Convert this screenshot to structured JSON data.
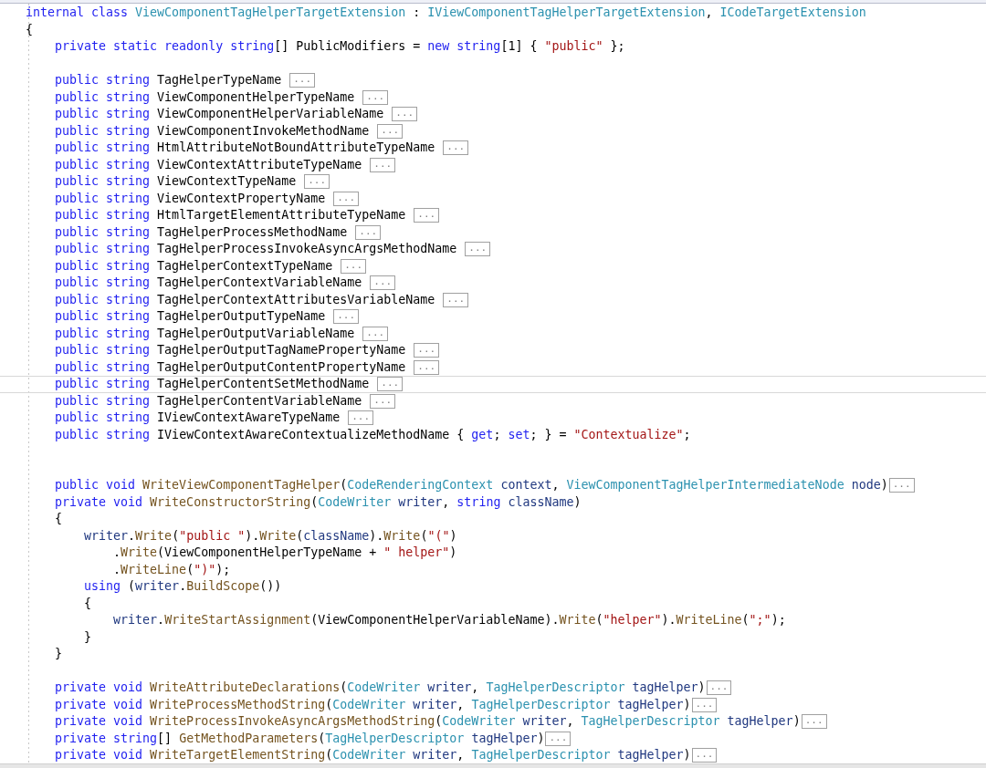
{
  "editor": {
    "lines": [
      {
        "kind": "code",
        "current": false,
        "tokens": [
          {
            "kind": "keyword",
            "text": "internal class "
          },
          {
            "kind": "type",
            "text": "ViewComponentTagHelperTargetExtension"
          },
          {
            "kind": "plain",
            "text": " : "
          },
          {
            "kind": "type",
            "text": "IViewComponentTagHelperTargetExtension"
          },
          {
            "kind": "plain",
            "text": ", "
          },
          {
            "kind": "type",
            "text": "ICodeTargetExtension"
          }
        ]
      },
      {
        "kind": "code",
        "current": false,
        "tokens": [
          {
            "kind": "plain",
            "text": "{"
          }
        ]
      },
      {
        "kind": "code",
        "current": false,
        "tokens": [
          {
            "kind": "keyword",
            "text": "    private static readonly string"
          },
          {
            "kind": "plain",
            "text": "[] PublicModifiers = "
          },
          {
            "kind": "keyword",
            "text": "new string"
          },
          {
            "kind": "plain",
            "text": "[1] { "
          },
          {
            "kind": "string",
            "text": "\"public\""
          },
          {
            "kind": "plain",
            "text": " };"
          }
        ]
      },
      {
        "kind": "blank",
        "current": false
      },
      {
        "kind": "code",
        "current": false,
        "fold": "...",
        "tokens": [
          {
            "kind": "keyword",
            "text": "    public string "
          },
          {
            "kind": "plain",
            "text": "TagHelperTypeName "
          }
        ]
      },
      {
        "kind": "code",
        "current": false,
        "fold": "...",
        "tokens": [
          {
            "kind": "keyword",
            "text": "    public string "
          },
          {
            "kind": "plain",
            "text": "ViewComponentHelperTypeName "
          }
        ]
      },
      {
        "kind": "code",
        "current": false,
        "fold": "...",
        "tokens": [
          {
            "kind": "keyword",
            "text": "    public string "
          },
          {
            "kind": "plain",
            "text": "ViewComponentHelperVariableName "
          }
        ]
      },
      {
        "kind": "code",
        "current": false,
        "fold": "...",
        "tokens": [
          {
            "kind": "keyword",
            "text": "    public string "
          },
          {
            "kind": "plain",
            "text": "ViewComponentInvokeMethodName "
          }
        ]
      },
      {
        "kind": "code",
        "current": false,
        "fold": "...",
        "tokens": [
          {
            "kind": "keyword",
            "text": "    public string "
          },
          {
            "kind": "plain",
            "text": "HtmlAttributeNotBoundAttributeTypeName "
          }
        ]
      },
      {
        "kind": "code",
        "current": false,
        "fold": "...",
        "tokens": [
          {
            "kind": "keyword",
            "text": "    public string "
          },
          {
            "kind": "plain",
            "text": "ViewContextAttributeTypeName "
          }
        ]
      },
      {
        "kind": "code",
        "current": false,
        "fold": "...",
        "tokens": [
          {
            "kind": "keyword",
            "text": "    public string "
          },
          {
            "kind": "plain",
            "text": "ViewContextTypeName "
          }
        ]
      },
      {
        "kind": "code",
        "current": false,
        "fold": "...",
        "tokens": [
          {
            "kind": "keyword",
            "text": "    public string "
          },
          {
            "kind": "plain",
            "text": "ViewContextPropertyName "
          }
        ]
      },
      {
        "kind": "code",
        "current": false,
        "fold": "...",
        "tokens": [
          {
            "kind": "keyword",
            "text": "    public string "
          },
          {
            "kind": "plain",
            "text": "HtmlTargetElementAttributeTypeName "
          }
        ]
      },
      {
        "kind": "code",
        "current": false,
        "fold": "...",
        "tokens": [
          {
            "kind": "keyword",
            "text": "    public string "
          },
          {
            "kind": "plain",
            "text": "TagHelperProcessMethodName "
          }
        ]
      },
      {
        "kind": "code",
        "current": false,
        "fold": "...",
        "tokens": [
          {
            "kind": "keyword",
            "text": "    public string "
          },
          {
            "kind": "plain",
            "text": "TagHelperProcessInvokeAsyncArgsMethodName "
          }
        ]
      },
      {
        "kind": "code",
        "current": false,
        "fold": "...",
        "tokens": [
          {
            "kind": "keyword",
            "text": "    public string "
          },
          {
            "kind": "plain",
            "text": "TagHelperContextTypeName "
          }
        ]
      },
      {
        "kind": "code",
        "current": false,
        "fold": "...",
        "tokens": [
          {
            "kind": "keyword",
            "text": "    public string "
          },
          {
            "kind": "plain",
            "text": "TagHelperContextVariableName "
          }
        ]
      },
      {
        "kind": "code",
        "current": false,
        "fold": "...",
        "tokens": [
          {
            "kind": "keyword",
            "text": "    public string "
          },
          {
            "kind": "plain",
            "text": "TagHelperContextAttributesVariableName "
          }
        ]
      },
      {
        "kind": "code",
        "current": false,
        "fold": "...",
        "tokens": [
          {
            "kind": "keyword",
            "text": "    public string "
          },
          {
            "kind": "plain",
            "text": "TagHelperOutputTypeName "
          }
        ]
      },
      {
        "kind": "code",
        "current": false,
        "fold": "...",
        "tokens": [
          {
            "kind": "keyword",
            "text": "    public string "
          },
          {
            "kind": "plain",
            "text": "TagHelperOutputVariableName "
          }
        ]
      },
      {
        "kind": "code",
        "current": false,
        "fold": "...",
        "tokens": [
          {
            "kind": "keyword",
            "text": "    public string "
          },
          {
            "kind": "plain",
            "text": "TagHelperOutputTagNamePropertyName "
          }
        ]
      },
      {
        "kind": "code",
        "current": false,
        "fold": "...",
        "tokens": [
          {
            "kind": "keyword",
            "text": "    public string "
          },
          {
            "kind": "plain",
            "text": "TagHelperOutputContentPropertyName "
          }
        ]
      },
      {
        "kind": "code",
        "current": true,
        "fold": "...",
        "tokens": [
          {
            "kind": "keyword",
            "text": "    public string "
          },
          {
            "kind": "plain",
            "text": "TagHelperContentSetMethodName "
          }
        ]
      },
      {
        "kind": "code",
        "current": false,
        "fold": "...",
        "tokens": [
          {
            "kind": "keyword",
            "text": "    public string "
          },
          {
            "kind": "plain",
            "text": "TagHelperContentVariableName "
          }
        ]
      },
      {
        "kind": "code",
        "current": false,
        "fold": "...",
        "tokens": [
          {
            "kind": "keyword",
            "text": "    public string "
          },
          {
            "kind": "plain",
            "text": "IViewContextAwareTypeName "
          }
        ]
      },
      {
        "kind": "code",
        "current": false,
        "tokens": [
          {
            "kind": "keyword",
            "text": "    public string "
          },
          {
            "kind": "plain",
            "text": "IViewContextAwareContextualizeMethodName { "
          },
          {
            "kind": "keyword",
            "text": "get"
          },
          {
            "kind": "plain",
            "text": "; "
          },
          {
            "kind": "keyword",
            "text": "set"
          },
          {
            "kind": "plain",
            "text": "; } = "
          },
          {
            "kind": "string",
            "text": "\"Contextualize\""
          },
          {
            "kind": "plain",
            "text": ";"
          }
        ]
      },
      {
        "kind": "blank",
        "current": false
      },
      {
        "kind": "blank",
        "current": false
      },
      {
        "kind": "code",
        "current": false,
        "fold": "...",
        "tokens": [
          {
            "kind": "keyword",
            "text": "    public void "
          },
          {
            "kind": "method",
            "text": "WriteViewComponentTagHelper"
          },
          {
            "kind": "plain",
            "text": "("
          },
          {
            "kind": "type",
            "text": "CodeRenderingContext"
          },
          {
            "kind": "variable",
            "text": " context"
          },
          {
            "kind": "plain",
            "text": ", "
          },
          {
            "kind": "type",
            "text": "ViewComponentTagHelperIntermediateNode"
          },
          {
            "kind": "variable",
            "text": " node"
          },
          {
            "kind": "plain",
            "text": ")"
          }
        ]
      },
      {
        "kind": "code",
        "current": false,
        "tokens": [
          {
            "kind": "keyword",
            "text": "    private void "
          },
          {
            "kind": "method",
            "text": "WriteConstructorString"
          },
          {
            "kind": "plain",
            "text": "("
          },
          {
            "kind": "type",
            "text": "CodeWriter"
          },
          {
            "kind": "variable",
            "text": " writer"
          },
          {
            "kind": "plain",
            "text": ", "
          },
          {
            "kind": "keyword",
            "text": "string"
          },
          {
            "kind": "variable",
            "text": " className"
          },
          {
            "kind": "plain",
            "text": ")"
          }
        ]
      },
      {
        "kind": "code",
        "current": false,
        "tokens": [
          {
            "kind": "plain",
            "text": "    {"
          }
        ]
      },
      {
        "kind": "code",
        "current": false,
        "tokens": [
          {
            "kind": "variable",
            "text": "        writer"
          },
          {
            "kind": "plain",
            "text": "."
          },
          {
            "kind": "method",
            "text": "Write"
          },
          {
            "kind": "plain",
            "text": "("
          },
          {
            "kind": "string",
            "text": "\"public \""
          },
          {
            "kind": "plain",
            "text": ")."
          },
          {
            "kind": "method",
            "text": "Write"
          },
          {
            "kind": "plain",
            "text": "("
          },
          {
            "kind": "variable",
            "text": "className"
          },
          {
            "kind": "plain",
            "text": ")."
          },
          {
            "kind": "method",
            "text": "Write"
          },
          {
            "kind": "plain",
            "text": "("
          },
          {
            "kind": "string",
            "text": "\"(\""
          },
          {
            "kind": "plain",
            "text": ")"
          }
        ]
      },
      {
        "kind": "code",
        "current": false,
        "tokens": [
          {
            "kind": "plain",
            "text": "            ."
          },
          {
            "kind": "method",
            "text": "Write"
          },
          {
            "kind": "plain",
            "text": "(ViewComponentHelperTypeName + "
          },
          {
            "kind": "string",
            "text": "\" helper\""
          },
          {
            "kind": "plain",
            "text": ")"
          }
        ]
      },
      {
        "kind": "code",
        "current": false,
        "tokens": [
          {
            "kind": "plain",
            "text": "            ."
          },
          {
            "kind": "method",
            "text": "WriteLine"
          },
          {
            "kind": "plain",
            "text": "("
          },
          {
            "kind": "string",
            "text": "\")\""
          },
          {
            "kind": "plain",
            "text": ");"
          }
        ]
      },
      {
        "kind": "code",
        "current": false,
        "tokens": [
          {
            "kind": "keyword",
            "text": "        using"
          },
          {
            "kind": "plain",
            "text": " ("
          },
          {
            "kind": "variable",
            "text": "writer"
          },
          {
            "kind": "plain",
            "text": "."
          },
          {
            "kind": "method",
            "text": "BuildScope"
          },
          {
            "kind": "plain",
            "text": "())"
          }
        ]
      },
      {
        "kind": "code",
        "current": false,
        "tokens": [
          {
            "kind": "plain",
            "text": "        {"
          }
        ]
      },
      {
        "kind": "code",
        "current": false,
        "tokens": [
          {
            "kind": "variable",
            "text": "            writer"
          },
          {
            "kind": "plain",
            "text": "."
          },
          {
            "kind": "method",
            "text": "WriteStartAssignment"
          },
          {
            "kind": "plain",
            "text": "(ViewComponentHelperVariableName)."
          },
          {
            "kind": "method",
            "text": "Write"
          },
          {
            "kind": "plain",
            "text": "("
          },
          {
            "kind": "string",
            "text": "\"helper\""
          },
          {
            "kind": "plain",
            "text": ")."
          },
          {
            "kind": "method",
            "text": "WriteLine"
          },
          {
            "kind": "plain",
            "text": "("
          },
          {
            "kind": "string",
            "text": "\";\""
          },
          {
            "kind": "plain",
            "text": ");"
          }
        ]
      },
      {
        "kind": "code",
        "current": false,
        "tokens": [
          {
            "kind": "plain",
            "text": "        }"
          }
        ]
      },
      {
        "kind": "code",
        "current": false,
        "tokens": [
          {
            "kind": "plain",
            "text": "    }"
          }
        ]
      },
      {
        "kind": "blank",
        "current": false
      },
      {
        "kind": "code",
        "current": false,
        "fold": "...",
        "tokens": [
          {
            "kind": "keyword",
            "text": "    private void "
          },
          {
            "kind": "method",
            "text": "WriteAttributeDeclarations"
          },
          {
            "kind": "plain",
            "text": "("
          },
          {
            "kind": "type",
            "text": "CodeWriter"
          },
          {
            "kind": "variable",
            "text": " writer"
          },
          {
            "kind": "plain",
            "text": ", "
          },
          {
            "kind": "type",
            "text": "TagHelperDescriptor"
          },
          {
            "kind": "variable",
            "text": " tagHelper"
          },
          {
            "kind": "plain",
            "text": ")"
          }
        ]
      },
      {
        "kind": "code",
        "current": false,
        "fold": "...",
        "tokens": [
          {
            "kind": "keyword",
            "text": "    private void "
          },
          {
            "kind": "method",
            "text": "WriteProcessMethodString"
          },
          {
            "kind": "plain",
            "text": "("
          },
          {
            "kind": "type",
            "text": "CodeWriter"
          },
          {
            "kind": "variable",
            "text": " writer"
          },
          {
            "kind": "plain",
            "text": ", "
          },
          {
            "kind": "type",
            "text": "TagHelperDescriptor"
          },
          {
            "kind": "variable",
            "text": " tagHelper"
          },
          {
            "kind": "plain",
            "text": ")"
          }
        ]
      },
      {
        "kind": "code",
        "current": false,
        "fold": "...",
        "tokens": [
          {
            "kind": "keyword",
            "text": "    private void "
          },
          {
            "kind": "method",
            "text": "WriteProcessInvokeAsyncArgsMethodString"
          },
          {
            "kind": "plain",
            "text": "("
          },
          {
            "kind": "type",
            "text": "CodeWriter"
          },
          {
            "kind": "variable",
            "text": " writer"
          },
          {
            "kind": "plain",
            "text": ", "
          },
          {
            "kind": "type",
            "text": "TagHelperDescriptor"
          },
          {
            "kind": "variable",
            "text": " tagHelper"
          },
          {
            "kind": "plain",
            "text": ")"
          }
        ]
      },
      {
        "kind": "code",
        "current": false,
        "fold": "...",
        "tokens": [
          {
            "kind": "keyword",
            "text": "    private string"
          },
          {
            "kind": "plain",
            "text": "[] "
          },
          {
            "kind": "method",
            "text": "GetMethodParameters"
          },
          {
            "kind": "plain",
            "text": "("
          },
          {
            "kind": "type",
            "text": "TagHelperDescriptor"
          },
          {
            "kind": "variable",
            "text": " tagHelper"
          },
          {
            "kind": "plain",
            "text": ")"
          }
        ]
      },
      {
        "kind": "code",
        "current": false,
        "fold": "...",
        "tokens": [
          {
            "kind": "keyword",
            "text": "    private void "
          },
          {
            "kind": "method",
            "text": "WriteTargetElementString"
          },
          {
            "kind": "plain",
            "text": "("
          },
          {
            "kind": "type",
            "text": "CodeWriter"
          },
          {
            "kind": "variable",
            "text": " writer"
          },
          {
            "kind": "plain",
            "text": ", "
          },
          {
            "kind": "type",
            "text": "TagHelperDescriptor"
          },
          {
            "kind": "variable",
            "text": " tagHelper"
          },
          {
            "kind": "plain",
            "text": ")"
          }
        ]
      }
    ]
  }
}
